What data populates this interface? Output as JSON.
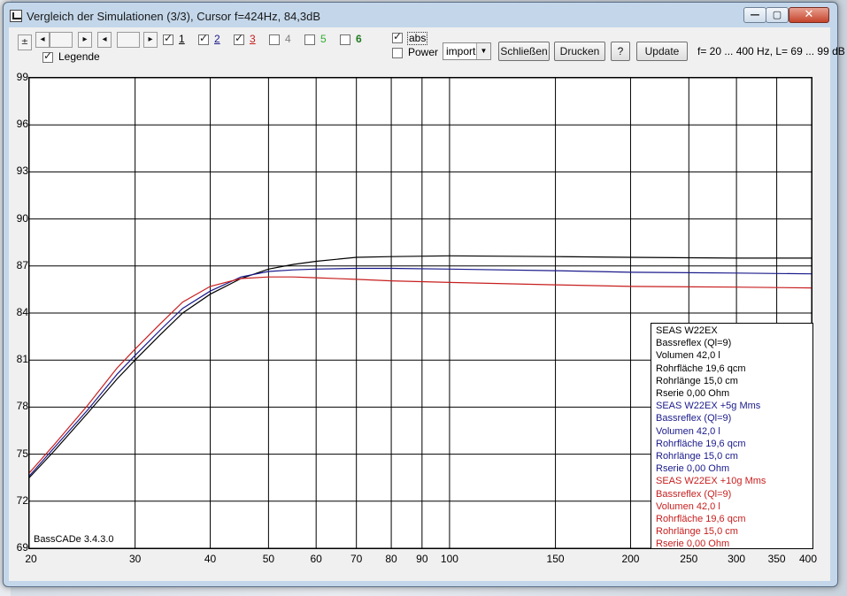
{
  "window": {
    "title": "Vergleich der Simulationen (3/3), Cursor f=424Hz, 84,3dB"
  },
  "toolbar": {
    "plus_minus": "±",
    "nav_buttons": [
      "◂",
      "",
      "▸",
      "◂",
      "",
      "▸"
    ],
    "series_toggles": [
      {
        "label": "1",
        "checked": true,
        "color": "#000000"
      },
      {
        "label": "2",
        "checked": true,
        "color": "#1a1a8c"
      },
      {
        "label": "3",
        "checked": true,
        "color": "#c81e1e"
      },
      {
        "label": "4",
        "checked": false,
        "color": "#808080"
      },
      {
        "label": "5",
        "checked": false,
        "color": "#2fae2f"
      },
      {
        "label": "6",
        "checked": false,
        "color": "#1f7a1f"
      }
    ],
    "legend_label": "Legende",
    "legend_checked": true,
    "abs_label": "abs",
    "abs_checked": true,
    "power_label": "Power",
    "power_checked": false,
    "import_select": "import",
    "close_label": "Schließen",
    "print_label": "Drucken",
    "help_label": "?",
    "update_label": "Update",
    "range_text": "f= 20 ... 400 Hz, L= 69 ... 99 dB"
  },
  "chart_data": {
    "type": "line",
    "title": "",
    "xlabel": "",
    "ylabel": "",
    "xscale": "log",
    "xlim": [
      20,
      400
    ],
    "ylim": [
      69,
      99
    ],
    "x_ticks": [
      20,
      30,
      40,
      50,
      60,
      70,
      80,
      90,
      100,
      150,
      200,
      250,
      300,
      350,
      400
    ],
    "y_ticks": [
      69,
      72,
      75,
      78,
      81,
      84,
      87,
      90,
      93,
      96,
      99
    ],
    "grid": true,
    "series": [
      {
        "name": "SEAS W22EX",
        "color": "#000000",
        "points": [
          [
            20,
            73.5
          ],
          [
            22,
            75.2
          ],
          [
            25,
            77.6
          ],
          [
            28,
            79.8
          ],
          [
            30,
            81.0
          ],
          [
            33,
            82.6
          ],
          [
            36,
            84.0
          ],
          [
            40,
            85.2
          ],
          [
            45,
            86.2
          ],
          [
            50,
            86.8
          ],
          [
            55,
            87.1
          ],
          [
            60,
            87.3
          ],
          [
            70,
            87.55
          ],
          [
            80,
            87.6
          ],
          [
            100,
            87.65
          ],
          [
            150,
            87.6
          ],
          [
            200,
            87.55
          ],
          [
            300,
            87.5
          ],
          [
            400,
            87.5
          ]
        ]
      },
      {
        "name": "SEAS W22EX +5g Mms",
        "color": "#1a1a8c",
        "points": [
          [
            20,
            73.6
          ],
          [
            22,
            75.4
          ],
          [
            25,
            77.8
          ],
          [
            28,
            80.1
          ],
          [
            30,
            81.3
          ],
          [
            33,
            82.9
          ],
          [
            36,
            84.3
          ],
          [
            40,
            85.4
          ],
          [
            45,
            86.3
          ],
          [
            50,
            86.65
          ],
          [
            55,
            86.75
          ],
          [
            60,
            86.8
          ],
          [
            70,
            86.85
          ],
          [
            80,
            86.85
          ],
          [
            100,
            86.8
          ],
          [
            150,
            86.7
          ],
          [
            200,
            86.6
          ],
          [
            300,
            86.55
          ],
          [
            400,
            86.5
          ]
        ]
      },
      {
        "name": "SEAS W22EX +10g Mms",
        "color": "#c81e1e",
        "points": [
          [
            20,
            73.8
          ],
          [
            22,
            75.6
          ],
          [
            25,
            78.1
          ],
          [
            28,
            80.5
          ],
          [
            30,
            81.7
          ],
          [
            33,
            83.3
          ],
          [
            36,
            84.7
          ],
          [
            40,
            85.7
          ],
          [
            45,
            86.2
          ],
          [
            50,
            86.3
          ],
          [
            55,
            86.3
          ],
          [
            60,
            86.25
          ],
          [
            70,
            86.15
          ],
          [
            80,
            86.05
          ],
          [
            100,
            85.95
          ],
          [
            150,
            85.8
          ],
          [
            200,
            85.7
          ],
          [
            300,
            85.65
          ],
          [
            400,
            85.6
          ]
        ]
      }
    ],
    "legend": {
      "placement": "bottom-right",
      "groups": [
        {
          "color": "#000000",
          "lines": [
            "SEAS W22EX",
            "Bassreflex (Ql=9)",
            "Volumen 42,0 l",
            "Rohrfläche 19,6 qcm",
            "Rohrlänge 15,0 cm",
            "Rserie 0,00 Ohm"
          ]
        },
        {
          "color": "#1a1a8c",
          "lines": [
            "SEAS W22EX +5g Mms",
            "Bassreflex (Ql=9)",
            "Volumen 42,0 l",
            "Rohrfläche 19,6 qcm",
            "Rohrlänge 15,0 cm",
            "Rserie 0,00 Ohm"
          ]
        },
        {
          "color": "#c81e1e",
          "lines": [
            "SEAS W22EX +10g Mms",
            "Bassreflex (Ql=9)",
            "Volumen 42,0 l",
            "Rohrfläche 19,6 qcm",
            "Rohrlänge 15,0 cm",
            "Rserie 0,00 Ohm"
          ]
        }
      ]
    },
    "annotation": "BassCADe 3.4.3.0"
  }
}
